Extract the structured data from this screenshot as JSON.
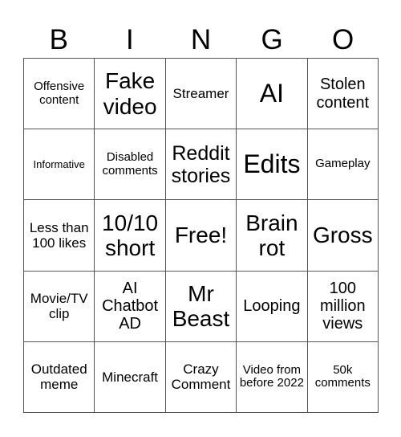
{
  "header": [
    "B",
    "I",
    "N",
    "G",
    "O"
  ],
  "cells": [
    {
      "text": "Offensive content",
      "size": "s2"
    },
    {
      "text": "Fake video",
      "size": "s6"
    },
    {
      "text": "Streamer",
      "size": "s3"
    },
    {
      "text": "AI",
      "size": "s7"
    },
    {
      "text": "Stolen content",
      "size": "s4"
    },
    {
      "text": "Informative",
      "size": "s1"
    },
    {
      "text": "Disabled comments",
      "size": "s2"
    },
    {
      "text": "Reddit stories",
      "size": "s5"
    },
    {
      "text": "Edits",
      "size": "s7"
    },
    {
      "text": "Gameplay",
      "size": "s2"
    },
    {
      "text": "Less than 100 likes",
      "size": "s3"
    },
    {
      "text": "10/10 short",
      "size": "s6"
    },
    {
      "text": "Free!",
      "size": "s6"
    },
    {
      "text": "Brain rot",
      "size": "s6"
    },
    {
      "text": "Gross",
      "size": "s6"
    },
    {
      "text": "Movie/TV clip",
      "size": "s3"
    },
    {
      "text": "AI Chatbot AD",
      "size": "s4"
    },
    {
      "text": "Mr Beast",
      "size": "s6"
    },
    {
      "text": "Looping",
      "size": "s4"
    },
    {
      "text": "100 million views",
      "size": "s4"
    },
    {
      "text": "Outdated meme",
      "size": "s3"
    },
    {
      "text": "Minecraft",
      "size": "s3"
    },
    {
      "text": "Crazy Comment",
      "size": "s3"
    },
    {
      "text": "Video from before 2022",
      "size": "s2"
    },
    {
      "text": "50k comments",
      "size": "s2"
    }
  ]
}
